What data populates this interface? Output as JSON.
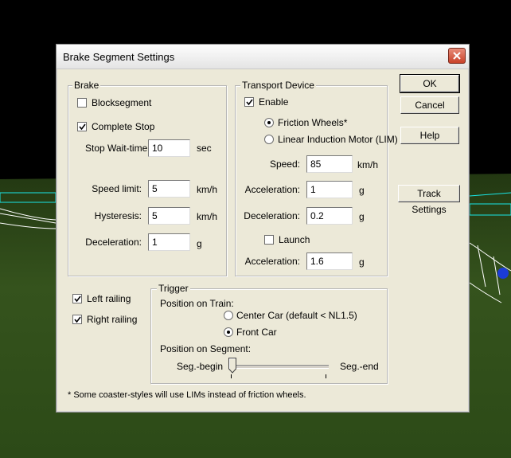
{
  "dialog": {
    "title": "Brake Segment Settings",
    "close_icon": "close-icon"
  },
  "brake": {
    "group_label": "Brake",
    "blocksegment": {
      "label": "Blocksegment",
      "checked": false
    },
    "complete_stop": {
      "label": "Complete Stop",
      "checked": true
    },
    "stop_wait_time": {
      "label": "Stop Wait-time:",
      "value": "10",
      "unit": "sec"
    },
    "speed_limit": {
      "label": "Speed limit:",
      "value": "5",
      "unit": "km/h"
    },
    "hysteresis": {
      "label": "Hysteresis:",
      "value": "5",
      "unit": "km/h"
    },
    "deceleration": {
      "label": "Deceleration:",
      "value": "1",
      "unit": "g"
    }
  },
  "transport": {
    "group_label": "Transport Device",
    "enable": {
      "label": "Enable",
      "checked": true
    },
    "friction_wheels": {
      "label": "Friction Wheels*",
      "selected": true
    },
    "lim": {
      "label": "Linear Induction Motor (LIM)",
      "selected": false
    },
    "speed": {
      "label": "Speed:",
      "value": "85",
      "unit": "km/h"
    },
    "acceleration": {
      "label": "Acceleration:",
      "value": "1",
      "unit": "g"
    },
    "deceleration": {
      "label": "Deceleration:",
      "value": "0.2",
      "unit": "g"
    },
    "launch": {
      "label": "Launch",
      "checked": false
    },
    "launch_acceleration": {
      "label": "Acceleration:",
      "value": "1.6",
      "unit": "g"
    }
  },
  "buttons": {
    "ok": "OK",
    "cancel": "Cancel",
    "help": "Help",
    "track_settings": "Track Settings"
  },
  "railing": {
    "left": {
      "label": "Left railing",
      "checked": true
    },
    "right": {
      "label": "Right railing",
      "checked": true
    }
  },
  "trigger": {
    "group_label": "Trigger",
    "position_on_train_label": "Position on Train:",
    "center_car": {
      "label": "Center Car (default < NL1.5)",
      "selected": false
    },
    "front_car": {
      "label": "Front Car",
      "selected": true
    },
    "position_on_segment_label": "Position on Segment:",
    "seg_begin_label": "Seg.-begin",
    "seg_end_label": "Seg.-end",
    "segment_position": 0.0
  },
  "footnote": "* Some coaster-styles will use LIMs instead of friction wheels.",
  "colors": {
    "dialog_bg": "#ece9d8",
    "scene_grass": "#3c5a1e",
    "track_cyan": "#19e6e6",
    "close_red": "#c9422a"
  }
}
